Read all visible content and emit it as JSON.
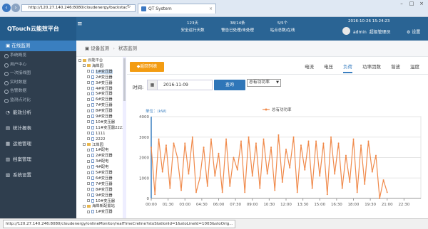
{
  "browser": {
    "address": "http://120.27.140.246:8080/cloudenergy/backstac",
    "tab_title": "QT System",
    "status_url": "http://120.27.140.246:8080/cloudenergy/onlineMonitor/realTimeCreline?stoStatIonId=1&stoLineId=1003&stoOrig..."
  },
  "header": {
    "brand": "QTouch云能效平台",
    "stats": [
      {
        "value": "123天",
        "label": "安全运行天数"
      },
      {
        "value": "38/14条",
        "label": "警告已处理/未处理"
      },
      {
        "value": "5/5个",
        "label": "站点总数/在线"
      }
    ],
    "date": "2016-10-26 15:24:23",
    "user": "admin",
    "role": "超级管理员",
    "settings": "设置"
  },
  "sidebar": {
    "active_section": "在线监测",
    "sub_items": [
      "系统概览",
      "用户中心",
      "一次接线图",
      "实时数据",
      "告警数据",
      "监测点对比"
    ],
    "items": [
      "能效分析",
      "统计报表",
      "运维管理",
      "档案管理",
      "系统设置"
    ]
  },
  "breadcrumb": [
    "设备监测",
    "状态监测"
  ],
  "tree": [
    {
      "label": "云能平台",
      "level": 0,
      "kind": "folder"
    },
    {
      "label": "海岸园",
      "level": 1,
      "kind": "folder"
    },
    {
      "label": "1#变压器",
      "level": 2,
      "kind": "file",
      "selected": true
    },
    {
      "label": "2#变压器",
      "level": 2,
      "kind": "file"
    },
    {
      "label": "3#变压器",
      "level": 2,
      "kind": "file"
    },
    {
      "label": "4#变压器",
      "level": 2,
      "kind": "file"
    },
    {
      "label": "5#变压器",
      "level": 2,
      "kind": "file"
    },
    {
      "label": "6#变压器",
      "level": 2,
      "kind": "file"
    },
    {
      "label": "7#变压器",
      "level": 2,
      "kind": "file"
    },
    {
      "label": "8#变压器",
      "level": 2,
      "kind": "file"
    },
    {
      "label": "9#变压器",
      "level": 2,
      "kind": "file"
    },
    {
      "label": "10#变压器",
      "level": 2,
      "kind": "file"
    },
    {
      "label": "11#变压器2222",
      "level": 2,
      "kind": "file"
    },
    {
      "label": "1111",
      "level": 2,
      "kind": "file"
    },
    {
      "label": "2222",
      "level": 2,
      "kind": "file"
    },
    {
      "label": "江岸园",
      "level": 1,
      "kind": "folder"
    },
    {
      "label": "1#配电",
      "level": 2,
      "kind": "file"
    },
    {
      "label": "2#变压器",
      "level": 2,
      "kind": "file"
    },
    {
      "label": "3#配电",
      "level": 2,
      "kind": "file"
    },
    {
      "label": "4#配电",
      "level": 2,
      "kind": "file"
    },
    {
      "label": "5#变压器",
      "level": 2,
      "kind": "file"
    },
    {
      "label": "6#变压器",
      "level": 2,
      "kind": "file"
    },
    {
      "label": "7#变压器",
      "level": 2,
      "kind": "file"
    },
    {
      "label": "8#变压器",
      "level": 2,
      "kind": "file"
    },
    {
      "label": "9#变压器",
      "level": 2,
      "kind": "file"
    },
    {
      "label": "10#变压器",
      "level": 2,
      "kind": "file"
    },
    {
      "label": "海岸新配置站",
      "level": 1,
      "kind": "folder"
    },
    {
      "label": "1#变压器",
      "level": 2,
      "kind": "file"
    }
  ],
  "main": {
    "back_label": "◆返回列表",
    "tabs": [
      "电流",
      "电压",
      "负荷",
      "功率因数",
      "谐波",
      "温度"
    ],
    "active_tab": "负荷",
    "time_label": "时间:",
    "date_value": "2016-11-09",
    "query_label": "查询",
    "select_value": "总有功功率"
  },
  "chart_data": {
    "type": "line",
    "ylabel": "单位：(kW)",
    "legend": "总有功功率",
    "ylim": [
      0,
      4000
    ],
    "yticks": [
      0,
      1000,
      2000,
      3000,
      4000
    ],
    "xticks": [
      "00:00",
      "01:30",
      "03:00",
      "04:30",
      "06:00",
      "07:30",
      "09:00",
      "10:30",
      "12:00",
      "13:30",
      "15:00",
      "16:30",
      "18:00",
      "19:30",
      "21:00",
      "22:30"
    ],
    "series": [
      {
        "name": "总有功功率",
        "color": "#f08a4b",
        "x_hours": [
          0,
          0.33,
          0.67,
          1,
          1.33,
          1.67,
          2,
          2.33,
          2.67,
          3,
          3.33,
          3.67,
          4,
          4.33,
          4.67,
          5,
          5.33,
          5.67,
          6,
          6.33,
          6.67,
          7,
          7.33,
          7.67,
          8,
          8.33,
          8.67,
          9,
          9.33,
          9.67,
          10,
          10.33,
          10.67,
          11,
          11.33,
          11.67,
          12,
          12.33,
          12.67,
          13,
          13.33,
          13.67,
          14,
          14.33,
          14.67,
          15,
          15.33,
          15.67,
          16,
          16.33,
          16.67,
          17,
          17.33,
          17.67,
          18,
          18.33,
          18.67,
          19,
          19.33,
          19.67,
          20,
          20.33,
          20.67,
          21
        ],
        "values": [
          2500,
          200,
          2900,
          1300,
          2600,
          500,
          2700,
          2000,
          400,
          2700,
          1200,
          3000,
          300,
          1000,
          2500,
          600,
          2900,
          1100,
          2200,
          300,
          2900,
          600,
          2000,
          1400,
          2800,
          300,
          3000,
          1100,
          2700,
          500,
          2900,
          1200,
          2500,
          400,
          3100,
          800,
          2400,
          1500,
          3000,
          300,
          2600,
          1400,
          2800,
          500,
          2800,
          1100,
          2700,
          200,
          3000,
          1200,
          2700,
          500,
          2100,
          800,
          2900,
          300,
          2600,
          700,
          2800,
          1300,
          2100,
          0,
          900,
          300
        ]
      }
    ]
  }
}
